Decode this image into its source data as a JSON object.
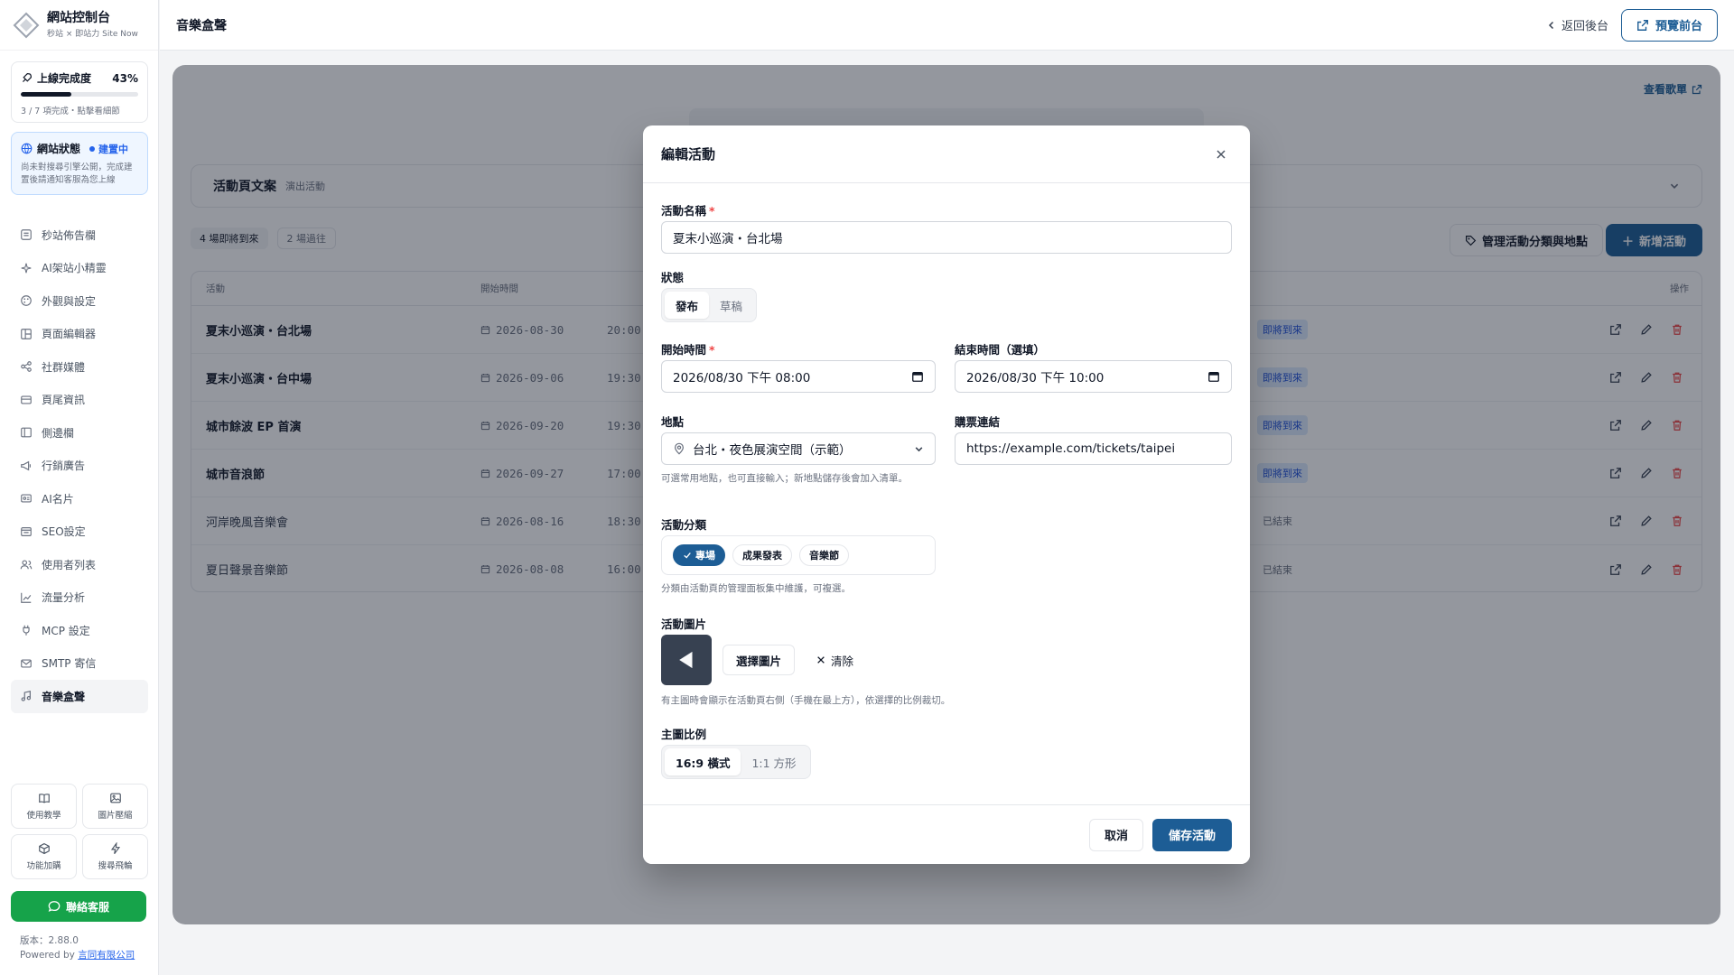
{
  "sidebar": {
    "brand_title": "網站控制台",
    "brand_sub": "秒站 × 即站力 Site Now",
    "progress_card": {
      "title": "上線完成度",
      "percent_label": "43%",
      "percent": 43,
      "note": "3 / 7 項完成・點擊看細節"
    },
    "status_card": {
      "title": "網站狀態",
      "badge": "建置中",
      "note": "尚未對搜尋引擎公開，完成建置後請通知客服為您上線"
    },
    "items": [
      {
        "label": "秒站佈告欄",
        "icon": "board-icon"
      },
      {
        "label": "AI架站小精靈",
        "icon": "sparkle-icon"
      },
      {
        "label": "外觀與設定",
        "icon": "palette-icon"
      },
      {
        "label": "頁面編輯器",
        "icon": "layout-icon"
      },
      {
        "label": "社群媒體",
        "icon": "share-icon"
      },
      {
        "label": "頁尾資訊",
        "icon": "card-icon"
      },
      {
        "label": "側邊欄",
        "icon": "sidebar-icon"
      },
      {
        "label": "行銷廣告",
        "icon": "megaphone-icon"
      },
      {
        "label": "AI名片",
        "icon": "id-card-icon"
      },
      {
        "label": "SEO設定",
        "icon": "seo-icon"
      },
      {
        "label": "使用者列表",
        "icon": "users-icon"
      },
      {
        "label": "流量分析",
        "icon": "chart-icon"
      },
      {
        "label": "MCP 設定",
        "icon": "plug-icon"
      },
      {
        "label": "SMTP 寄信",
        "icon": "mail-icon"
      },
      {
        "label": "音樂盒聲",
        "icon": "music-icon"
      }
    ],
    "tiles": [
      {
        "label": "使用教學",
        "icon": "book-icon"
      },
      {
        "label": "圖片壓縮",
        "icon": "image-icon"
      },
      {
        "label": "功能加購",
        "icon": "box-icon"
      },
      {
        "label": "搜尋飛輪",
        "icon": "bolt-icon"
      }
    ],
    "support_label": "聯絡客服",
    "version": "版本：2.88.0",
    "powered_prefix": "Powered by ",
    "powered_company": "言同有限公司"
  },
  "topbar": {
    "title": "音樂盒聲",
    "back_label": "返回後台",
    "preview_label": "預覽前台"
  },
  "background": {
    "view_list": "查看歌單",
    "section_title": "活動頁文案",
    "section_sub": "演出活動",
    "pill_upcoming": "4 場即將到來",
    "pill_past": "2 場過往",
    "manage_label": "管理活動分類與地點",
    "new_label": "新增活動",
    "columns": {
      "name": "活動",
      "time": "開始時間",
      "ops": "操作"
    },
    "rows": [
      {
        "name": "夏末小巡演・台北場",
        "date": "2026-08-30",
        "time": "20:00",
        "status": "即將到來",
        "past": false
      },
      {
        "name": "夏末小巡演・台中場",
        "date": "2026-09-06",
        "time": "19:30",
        "status": "即將到來",
        "past": false
      },
      {
        "name": "城市餘波 EP 首演",
        "date": "2026-09-20",
        "time": "19:30",
        "status": "即將到來",
        "past": false
      },
      {
        "name": "城市音浪節",
        "date": "2026-09-27",
        "time": "17:00",
        "status": "即將到來",
        "past": false
      },
      {
        "name": "河岸晚風音樂會",
        "date": "2026-08-16",
        "time": "18:30",
        "status": "已結束",
        "past": true
      },
      {
        "name": "夏日聲景音樂節",
        "date": "2026-08-08",
        "time": "16:00",
        "status": "已結束",
        "past": true
      }
    ]
  },
  "modal": {
    "title": "編輯活動",
    "name_label": "活動名稱",
    "name_value": "夏末小巡演・台北場",
    "status_label": "狀態",
    "status_options": [
      "發布",
      "草稿"
    ],
    "start_label": "開始時間",
    "start_value": "2026/08/30 下午 08:00",
    "end_label": "結束時間（選填）",
    "end_value": "2026/08/30 下午 10:00",
    "venue_label": "地點",
    "venue_value": "台北・夜色展演空間（示範）",
    "venue_help": "可選常用地點，也可直接輸入；新地點儲存後會加入清單。",
    "ticket_label": "購票連結",
    "ticket_value": "https://example.com/tickets/taipei",
    "category_label": "活動分類",
    "categories": [
      {
        "label": "專場",
        "selected": true
      },
      {
        "label": "成果發表",
        "selected": false
      },
      {
        "label": "音樂節",
        "selected": false
      }
    ],
    "category_help": "分類由活動頁的管理面板集中維護，可複選。",
    "image_label": "活動圖片",
    "choose_image": "選擇圖片",
    "clear_image": "清除",
    "image_help": "有主圖時會顯示在活動頁右側（手機在最上方），依選擇的比例裁切。",
    "ratio_label": "主圖比例",
    "ratio_options": [
      "16:9 橫式",
      "1:1 方形"
    ],
    "cancel": "取消",
    "save": "儲存活動"
  },
  "colors": {
    "accent": "#1d5d95",
    "success": "#16a34a",
    "required": "#ef4444"
  }
}
